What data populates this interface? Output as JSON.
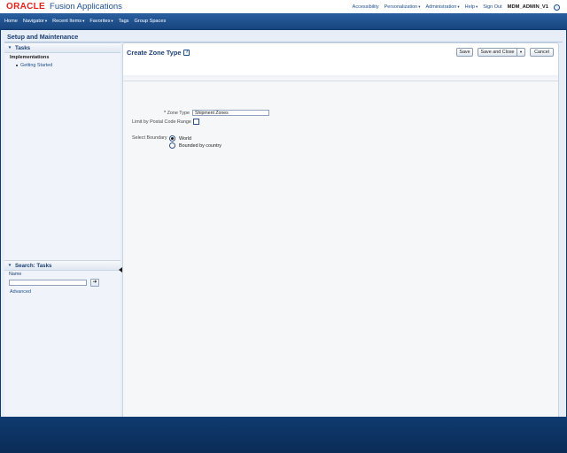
{
  "brand": {
    "logo_text": "ORACLE",
    "app_name": "Fusion Applications"
  },
  "global_links": {
    "accessibility": "Accessibility",
    "personalization": "Personalization",
    "administration": "Administration",
    "help": "Help",
    "sign_out": "Sign Out",
    "user": "MDM_ADMIN_V1",
    "caret": "▾"
  },
  "nav": {
    "home": "Home",
    "navigator": "Navigator",
    "recent_items": "Recent Items",
    "favorites": "Favorites",
    "tags": "Tags",
    "group_spaces": "Group Spaces",
    "caret": "▾"
  },
  "page": {
    "title": "Setup and Maintenance"
  },
  "tasks_pane": {
    "title": "Tasks",
    "toggle": "▾",
    "section": "Implementations",
    "items": [
      "Getting Started"
    ]
  },
  "search_pane": {
    "title": "Search: Tasks",
    "toggle": "▾",
    "name_label": "Name",
    "name_value": "",
    "go_symbol": "➜",
    "advanced": "Advanced"
  },
  "form": {
    "title": "Create Zone Type",
    "help_symbol": "?",
    "buttons": {
      "save": "Save",
      "save_and_close": "Save and Close",
      "menu_caret": "▾",
      "cancel": "Cancel"
    },
    "zone_type": {
      "required_mark": "*",
      "label": "Zone Type",
      "value": "Shipment Zones"
    },
    "limit_postal": {
      "label": "Limit by Postal Code Range",
      "checked": false
    },
    "boundary": {
      "label": "Select Boundary",
      "options": [
        {
          "label": "World",
          "selected": true
        },
        {
          "label": "Bounded by country",
          "selected": false
        }
      ]
    }
  }
}
